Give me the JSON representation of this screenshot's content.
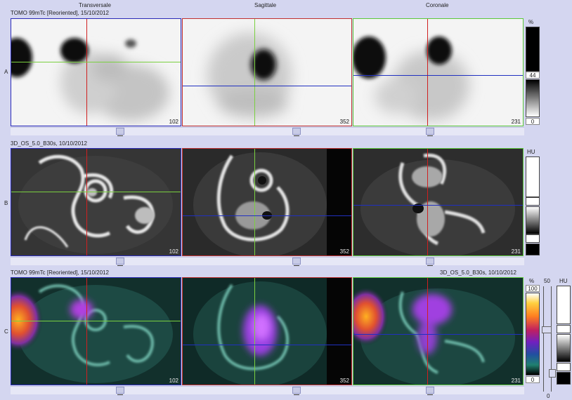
{
  "view_titles": {
    "transversale": "Transversale",
    "sagittale": "Sagittale",
    "coronale": "Coronale"
  },
  "rows": {
    "a": {
      "letter": "A",
      "series": "TOMO 99mTc [Reoriented], 15/10/2012",
      "slices": [
        "102",
        "352",
        "231"
      ],
      "scale": {
        "unit": "%",
        "value": "44",
        "min": "0"
      }
    },
    "b": {
      "letter": "B",
      "series": "3D_OS_5.0_B30s, 10/10/2012",
      "slices": [
        "102",
        "352",
        "231"
      ],
      "scale": {
        "unit": "HU"
      }
    },
    "c": {
      "letter": "C",
      "series_left": "TOMO 99mTc [Reoriented], 15/10/2012",
      "series_right": "3D_OS_5.0_B30s, 10/10/2012",
      "slices": [
        "102",
        "352",
        "231"
      ],
      "scale": {
        "unit_pct": "%",
        "max": "100",
        "min": "0",
        "blend_label": "50",
        "unit_hu": "HU",
        "blend_min": "0"
      }
    }
  },
  "colors": {
    "transversale_border": "#2b2bb8",
    "sagittale_border": "#c03030",
    "coronale_border": "#5cc83a",
    "crosshair_red": "#d02020",
    "crosshair_green": "#7ad040",
    "crosshair_blue": "#2030c0"
  }
}
